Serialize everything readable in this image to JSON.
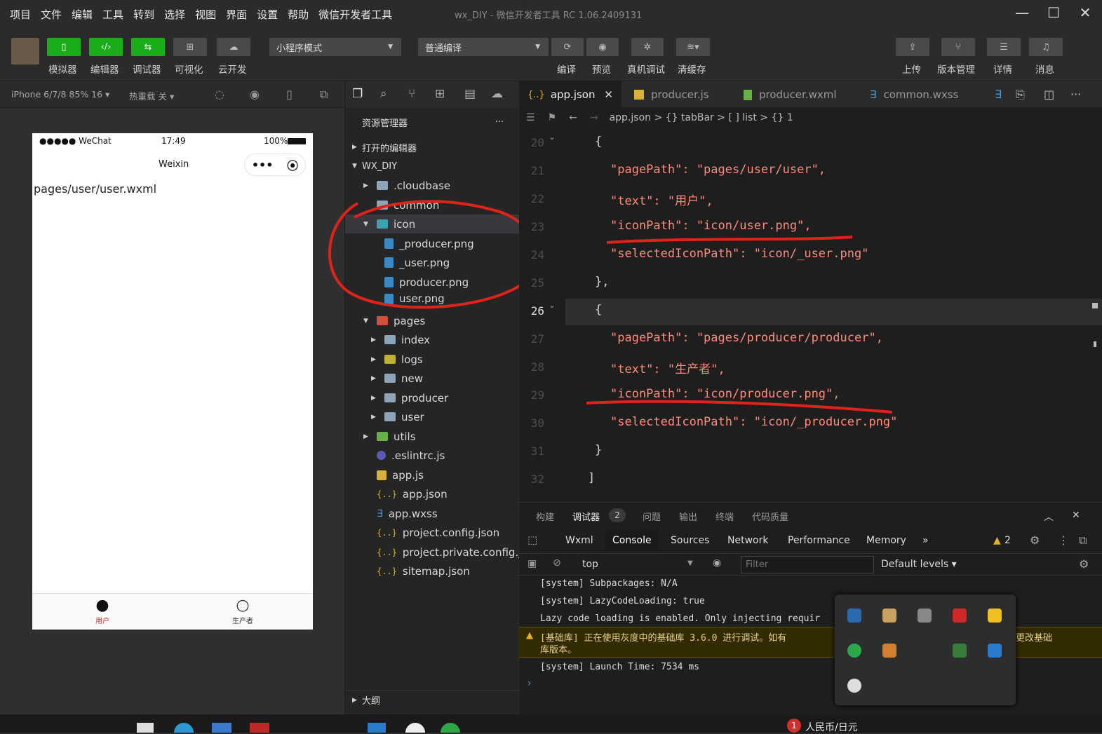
{
  "menubar": {
    "items": [
      "项目",
      "文件",
      "编辑",
      "工具",
      "转到",
      "选择",
      "视图",
      "界面",
      "设置",
      "帮助",
      "微信开发者工具"
    ],
    "window_title": "wx_DIY - 微信开发者工具 RC 1.06.2409131"
  },
  "toolbar": {
    "simulator": "模拟器",
    "editor": "编辑器",
    "debugger": "调试器",
    "visual": "可视化",
    "cloud": "云开发",
    "mode": "小程序模式",
    "compile_mode": "普通编译",
    "compile": "编译",
    "preview": "预览",
    "real_debug": "真机调试",
    "clear_cache": "清缓存",
    "upload": "上传",
    "version": "版本管理",
    "details": "详情",
    "messages": "消息"
  },
  "simbar": {
    "device": "iPhone 6/7/8 85% 16 ▾",
    "hotreload": "热重载 关 ▾"
  },
  "phone": {
    "carrier": "●●●●● WeChat",
    "time": "17:49",
    "battery": "100%",
    "nav_title": "Weixin",
    "content": "pages/user/user.wxml",
    "tab1": "用户",
    "tab2": "生产者"
  },
  "explorer": {
    "title": "资源管理器",
    "open_editors": "打开的编辑器",
    "project": "WX_DIY",
    "outline": "大纲",
    "rows": [
      {
        "name": ".cloudbase"
      },
      {
        "name": "common"
      },
      {
        "name": "icon"
      },
      {
        "name": "_producer.png"
      },
      {
        "name": "_user.png"
      },
      {
        "name": "producer.png"
      },
      {
        "name": "user.png"
      },
      {
        "name": "pages"
      },
      {
        "name": "index"
      },
      {
        "name": "logs"
      },
      {
        "name": "new"
      },
      {
        "name": "producer"
      },
      {
        "name": "user"
      },
      {
        "name": "utils"
      },
      {
        "name": ".eslintrc.js"
      },
      {
        "name": "app.js"
      },
      {
        "name": "app.json"
      },
      {
        "name": "app.wxss"
      },
      {
        "name": "project.config.json"
      },
      {
        "name": "project.private.config.js..."
      },
      {
        "name": "sitemap.json"
      }
    ]
  },
  "tabs": [
    "app.json",
    "producer.js",
    "producer.wxml",
    "common.wxss"
  ],
  "breadcrumb": "app.json > {} tabBar > [ ] list > {} 1",
  "editor": {
    "line_numbers": [
      "20",
      "21",
      "22",
      "23",
      "24",
      "25",
      "26",
      "27",
      "28",
      "29",
      "30",
      "31",
      "32"
    ],
    "lines": [
      "{",
      "\"pagePath\": \"pages/user/user\",",
      "\"text\": \"用户\",",
      "\"iconPath\": \"icon/user.png\",",
      "\"selectedIconPath\": \"icon/_user.png\"",
      "},",
      "{",
      "\"pagePath\": \"pages/producer/producer\",",
      "\"text\": \"生产者\",",
      "\"iconPath\": \"icon/producer.png\",",
      "\"selectedIconPath\": \"icon/_producer.png\"",
      "}",
      "]"
    ]
  },
  "panel": {
    "tabs": [
      "构建",
      "调试器",
      "问题",
      "输出",
      "终端",
      "代码质量"
    ],
    "debug_badge": "2",
    "devtabs": [
      "Wxml",
      "Console",
      "Sources",
      "Network",
      "Performance",
      "Memory",
      "»"
    ],
    "warn_count": "2",
    "context": "top",
    "filter_placeholder": "Filter",
    "levels": "Default levels ▾",
    "logs": [
      "[system] Subpackages: N/A",
      "[system] LazyCodeLoading: true",
      "Lazy code loading is enabled. Only injecting requir",
      "[基础库] 正在使用灰度中的基础库 3.6.0 进行调试。如有",
      "库版本。",
      "[system] Launch Time: 7534 ms"
    ],
    "warn_tail": "更改基础"
  },
  "taskbar": {
    "currency": "人民币/日元",
    "notif": "1"
  }
}
